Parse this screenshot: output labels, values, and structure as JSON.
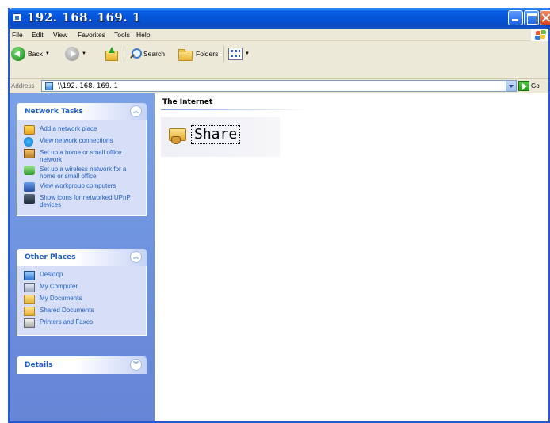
{
  "window": {
    "title": "192. 168. 169. 1"
  },
  "menu": [
    "File",
    "Edit",
    "View",
    "Favorites",
    "Tools",
    "Help"
  ],
  "toolbar": {
    "back_label": "Back",
    "search_label": "Search",
    "folders_label": "Folders"
  },
  "address": {
    "label": "Address",
    "value": "\\\\192. 168. 169. 1",
    "go_label": "Go"
  },
  "network_tasks": {
    "title": "Network Tasks",
    "items": [
      {
        "label": "Add a network place",
        "icon": "add-network-place-icon"
      },
      {
        "label": "View network connections",
        "icon": "network-connections-icon"
      },
      {
        "label": "Set up a home or small office network",
        "icon": "home-network-icon"
      },
      {
        "label": "Set up a wireless network for a home or small office",
        "icon": "wireless-network-icon"
      },
      {
        "label": "View workgroup computers",
        "icon": "workgroup-computers-icon"
      },
      {
        "label": "Show icons for networked UPnP devices",
        "icon": "upnp-devices-icon"
      }
    ]
  },
  "other_places": {
    "title": "Other Places",
    "items": [
      {
        "label": "Desktop",
        "icon": "desktop-icon"
      },
      {
        "label": "My Computer",
        "icon": "my-computer-icon"
      },
      {
        "label": "My Documents",
        "icon": "my-documents-icon"
      },
      {
        "label": "Shared Documents",
        "icon": "shared-documents-icon"
      },
      {
        "label": "Printers and Faxes",
        "icon": "printers-faxes-icon"
      }
    ]
  },
  "details": {
    "title": "Details"
  },
  "main": {
    "group_header": "The Internet",
    "share_label": "Share"
  }
}
